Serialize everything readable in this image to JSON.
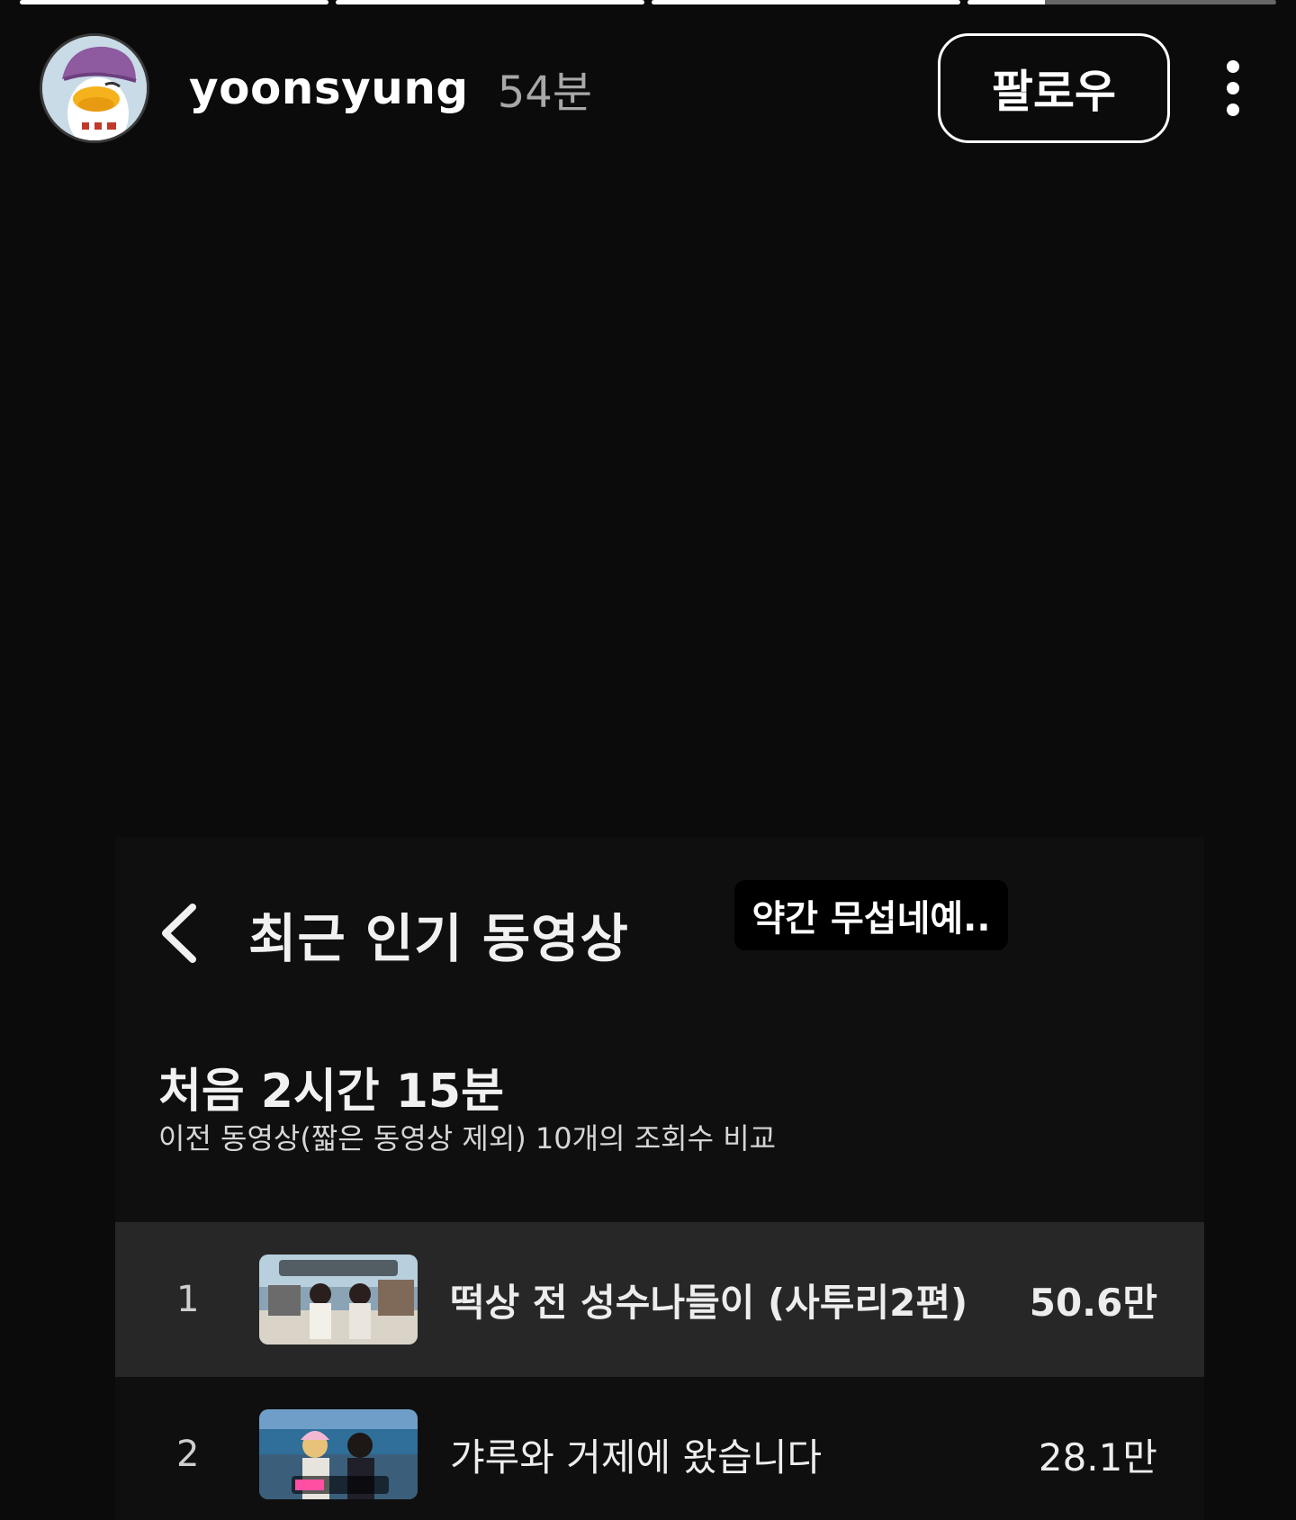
{
  "story": {
    "progress": [
      1,
      1,
      1,
      0.25
    ],
    "username": "yoonsyung",
    "time": "54분",
    "follow_label": "팔로우",
    "more_icon": "more-vertical-icon"
  },
  "panel": {
    "back_icon": "chevron-left-icon",
    "title": "최근 인기 동영상",
    "caption": "약간 무섭네예..",
    "duration": "처음 2시간 15분",
    "subtitle": "이전 동영상(짧은 동영상 제외) 10개의 조회수 비교",
    "videos": [
      {
        "rank": "1",
        "title": "떡상 전 성수나들이 (사투리2편)",
        "views": "50.6만",
        "highlighted": true
      },
      {
        "rank": "2",
        "title": "갸루와 거제에 왔습니다",
        "views": "28.1만",
        "highlighted": false
      }
    ]
  },
  "colors": {
    "background": "#0b0b0b",
    "highlight_row": "#272727",
    "muted_text": "#a8a8a8"
  }
}
